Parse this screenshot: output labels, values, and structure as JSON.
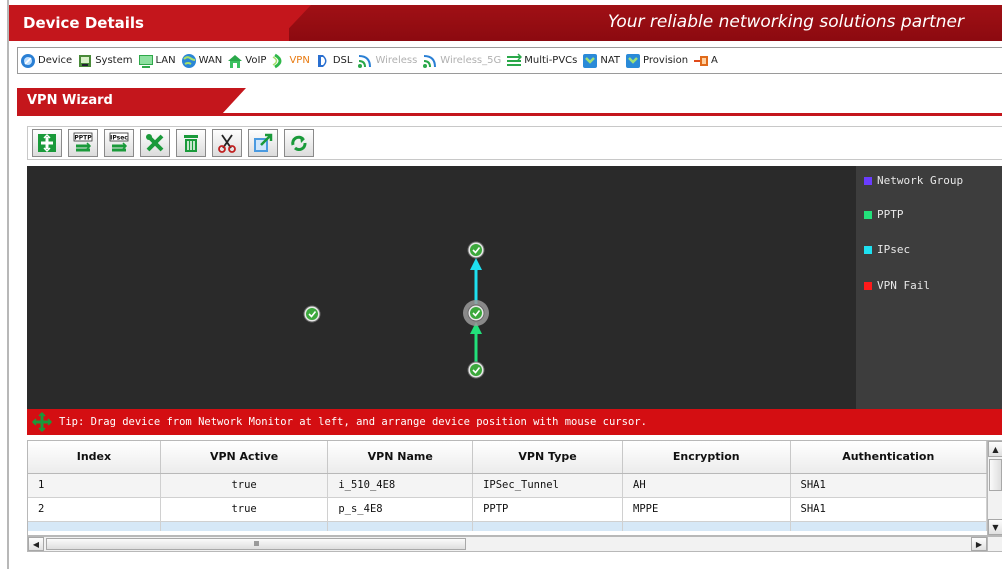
{
  "header": {
    "title": "Device Details",
    "slogan": "Your reliable networking solutions partner"
  },
  "nav": [
    {
      "label": "Device",
      "icon": "device-icon",
      "state": "normal"
    },
    {
      "label": "System",
      "icon": "system-icon",
      "state": "normal"
    },
    {
      "label": "LAN",
      "icon": "lan-icon",
      "state": "normal"
    },
    {
      "label": "WAN",
      "icon": "wan-icon",
      "state": "normal"
    },
    {
      "label": "VoIP",
      "icon": "voip-icon",
      "state": "normal"
    },
    {
      "label": "VPN",
      "icon": "vpn-icon",
      "state": "active"
    },
    {
      "label": "DSL",
      "icon": "dsl-icon",
      "state": "normal"
    },
    {
      "label": "Wireless",
      "icon": "wireless-icon",
      "state": "disabled"
    },
    {
      "label": "Wireless_5G",
      "icon": "wireless-5g-icon",
      "state": "disabled"
    },
    {
      "label": "Multi-PVCs",
      "icon": "multi-pvcs-icon",
      "state": "normal"
    },
    {
      "label": "NAT",
      "icon": "nat-icon",
      "state": "normal"
    },
    {
      "label": "Provision",
      "icon": "provision-icon",
      "state": "normal"
    },
    {
      "label": "A",
      "icon": "more-icon",
      "state": "normal"
    }
  ],
  "section": {
    "title": "VPN Wizard"
  },
  "toolbar": [
    {
      "name": "add-button",
      "icon": "add-icon"
    },
    {
      "name": "pptp-button",
      "icon": "pptp-icon",
      "text": "PPTP"
    },
    {
      "name": "ipsec-button",
      "icon": "ipsec-icon",
      "text": "IPsec"
    },
    {
      "name": "edit-button",
      "icon": "tools-icon"
    },
    {
      "name": "delete-button",
      "icon": "trash-icon"
    },
    {
      "name": "cut-button",
      "icon": "scissors-icon"
    },
    {
      "name": "export-button",
      "icon": "export-icon"
    },
    {
      "name": "refresh-button",
      "icon": "refresh-icon"
    }
  ],
  "legend": [
    {
      "label": "Network Group",
      "color": "#6a3cff"
    },
    {
      "label": "PPTP",
      "color": "#22e07a"
    },
    {
      "label": "IPsec",
      "color": "#1ee0f0"
    },
    {
      "label": "VPN Fail",
      "color": "#ff1a1a"
    }
  ],
  "tip": {
    "text": "Tip: Drag device from Network Monitor at left, and arrange device position with mouse cursor."
  },
  "table": {
    "columns": [
      "Index",
      "VPN Active",
      "VPN Name",
      "VPN Type",
      "Encryption",
      "Authentication"
    ],
    "rows": [
      [
        "1",
        "true",
        "i_510_4E8",
        "IPSec_Tunnel",
        "AH",
        "SHA1"
      ],
      [
        "2",
        "true",
        "p_s_4E8",
        "PPTP",
        "MPPE",
        "SHA1"
      ]
    ]
  },
  "scroll": {
    "thumb_grip": "IIIII"
  },
  "colors": {
    "brand_red": "#c4161c",
    "canvas_bg": "#2a2a2a",
    "legend_bg": "#3d3d3d",
    "ipsec_link": "#1ee0f0",
    "pptp_link": "#22e07a"
  }
}
